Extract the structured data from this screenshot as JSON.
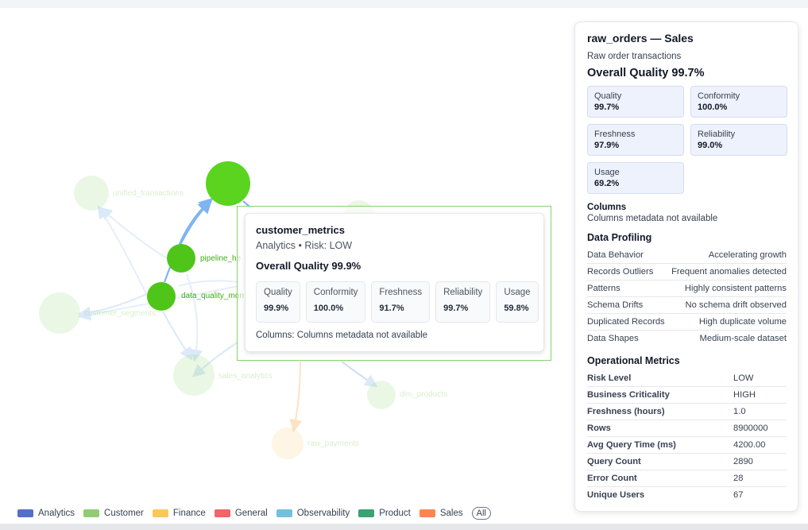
{
  "graph": {
    "nodes": [
      {
        "label": "unified_transactions",
        "color": "#8fd06f",
        "faded": true
      },
      {
        "label": "",
        "color": "#5ad41f",
        "faded": false
      },
      {
        "label": "pipeline_he",
        "color": "#4fc51a",
        "faded": false
      },
      {
        "label": "data_quality_mon",
        "color": "#4fc51a",
        "faded": false
      },
      {
        "label": "customer_segments",
        "color": "#8fd06f",
        "faded": true
      },
      {
        "label": "sales_analytics",
        "color": "#8fd06f",
        "faded": true
      },
      {
        "label": "dim_products",
        "color": "#8fd06f",
        "faded": true
      },
      {
        "label": "raw_payments",
        "color": "#f7c76a",
        "faded": true
      },
      {
        "label": "",
        "color": "#8fd06f",
        "faded": true
      }
    ]
  },
  "tooltip": {
    "title": "customer_metrics",
    "subtitle": "Analytics • Risk: LOW",
    "overall": "Overall Quality 99.9%",
    "metrics": [
      {
        "label": "Quality",
        "value": "99.9%"
      },
      {
        "label": "Conformity",
        "value": "100.0%"
      },
      {
        "label": "Freshness",
        "value": "91.7%"
      },
      {
        "label": "Reliability",
        "value": "99.7%"
      },
      {
        "label": "Usage",
        "value": "59.8%"
      }
    ],
    "columns": "Columns: Columns metadata not available"
  },
  "panel": {
    "title": "raw_orders — Sales",
    "description": "Raw order transactions",
    "overall": "Overall Quality 99.7%",
    "cards": [
      {
        "label": "Quality",
        "value": "99.7%"
      },
      {
        "label": "Conformity",
        "value": "100.0%"
      },
      {
        "label": "Freshness",
        "value": "97.9%"
      },
      {
        "label": "Reliability",
        "value": "99.0%"
      },
      {
        "label": "Usage",
        "value": "69.2%"
      }
    ],
    "columns_heading": "Columns",
    "columns_text": "Columns metadata not available",
    "profiling_heading": "Data Profiling",
    "profiling": [
      {
        "key": "Data Behavior",
        "value": "Accelerating growth"
      },
      {
        "key": "Records Outliers",
        "value": "Frequent anomalies detected"
      },
      {
        "key": "Patterns",
        "value": "Highly consistent patterns"
      },
      {
        "key": "Schema Drifts",
        "value": "No schema drift observed"
      },
      {
        "key": "Duplicated Records",
        "value": "High duplicate volume"
      },
      {
        "key": "Data Shapes",
        "value": "Medium-scale dataset"
      }
    ],
    "operational_heading": "Operational Metrics",
    "operational": [
      {
        "key": "Risk Level",
        "value": "LOW"
      },
      {
        "key": "Business Criticality",
        "value": "HIGH"
      },
      {
        "key": "Freshness (hours)",
        "value": "1.0"
      },
      {
        "key": "Rows",
        "value": "8900000"
      },
      {
        "key": "Avg Query Time (ms)",
        "value": "4200.00"
      },
      {
        "key": "Query Count",
        "value": "2890"
      },
      {
        "key": "Error Count",
        "value": "28"
      },
      {
        "key": "Unique Users",
        "value": "67"
      }
    ]
  },
  "legend": {
    "items": [
      {
        "label": "Analytics",
        "color": "#5470c6"
      },
      {
        "label": "Customer",
        "color": "#91cc75"
      },
      {
        "label": "Finance",
        "color": "#fac858"
      },
      {
        "label": "General",
        "color": "#ee6666"
      },
      {
        "label": "Observability",
        "color": "#73c0de"
      },
      {
        "label": "Product",
        "color": "#3ba272"
      },
      {
        "label": "Sales",
        "color": "#fc8452"
      }
    ],
    "all_label": "All"
  }
}
